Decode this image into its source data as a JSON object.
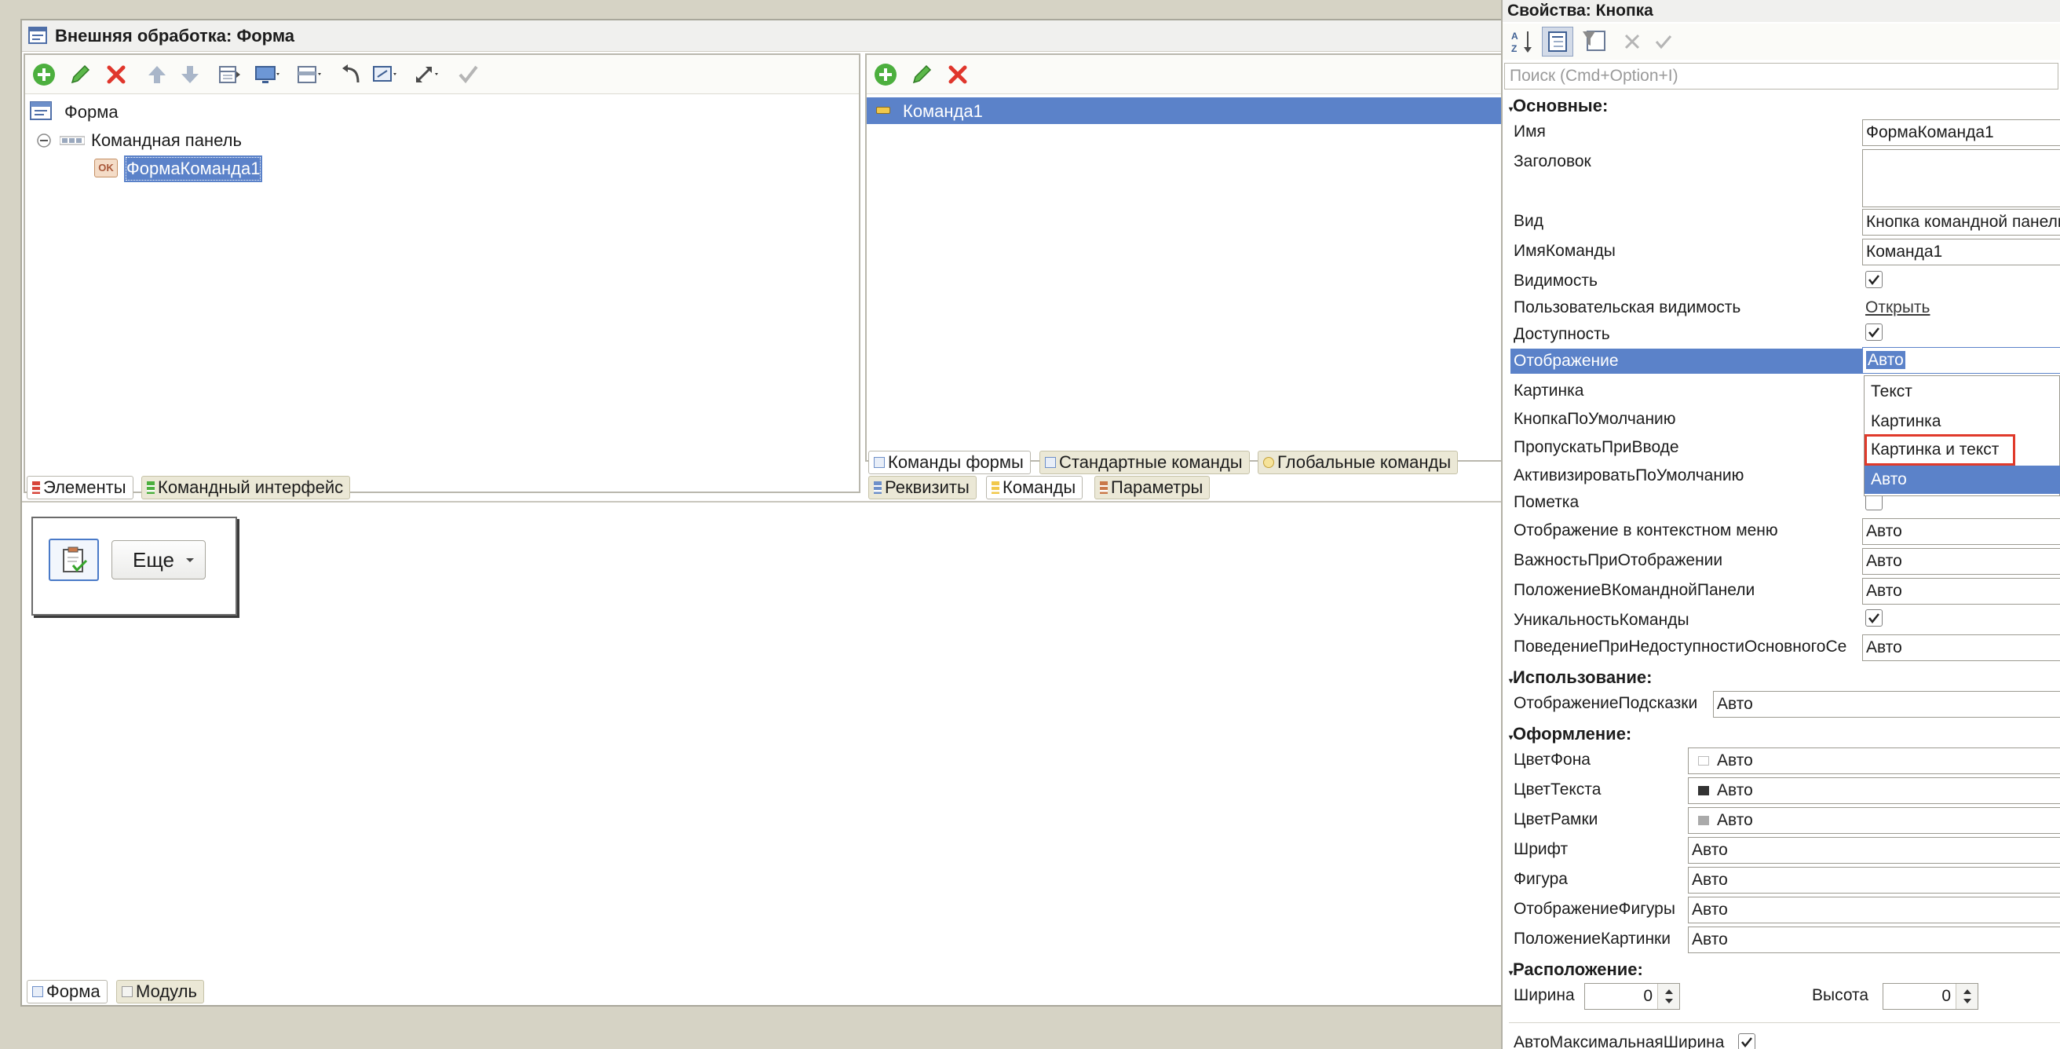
{
  "window": {
    "title": "Внешняя обработка: Форма"
  },
  "elements_pane": {
    "tree": {
      "root": "Форма",
      "command_bar": "Командная панель",
      "selected_item": "ФормаКоманда1",
      "item_badge": "OK"
    },
    "tabs": [
      "Элементы",
      "Командный интерфейс"
    ]
  },
  "commands_pane": {
    "list": [
      "Команда1"
    ],
    "tabs_row1": [
      "Команды формы",
      "Стандартные команды",
      "Глобальные команды"
    ],
    "tabs_row2": [
      "Реквизиты",
      "Команды",
      "Параметры"
    ]
  },
  "preview": {
    "more_button": "Еще"
  },
  "bottom_tabs": [
    "Форма",
    "Модуль"
  ],
  "properties": {
    "title": "Свойства: Кнопка",
    "search_placeholder": "Поиск (Cmd+Option+I)",
    "groups": {
      "main": "Основные:",
      "usage": "Использование:",
      "appearance": "Оформление:",
      "layout": "Расположение:"
    },
    "main": {
      "name_label": "Имя",
      "name_value": "ФормаКоманда1",
      "title_label": "Заголовок",
      "title_value": "",
      "kind_label": "Вид",
      "kind_value": "Кнопка командной панели",
      "command_label": "ИмяКоманды",
      "command_value": "Команда1",
      "visible_label": "Видимость",
      "visible_checked": true,
      "user_visible_label": "Пользовательская видимость",
      "user_visible_link": "Открыть",
      "enabled_label": "Доступность",
      "enabled_checked": true,
      "display_label": "Отображение",
      "display_value": "Авто",
      "picture_label": "Картинка",
      "default_button_label": "КнопкаПоУмолчанию",
      "skip_on_input_label": "ПропускатьПриВводе",
      "activate_default_label": "АктивизироватьПоУмолчанию",
      "check_label": "Пометка",
      "check_checked": false,
      "context_menu_label": "Отображение в контекстном меню",
      "context_menu_value": "Авто",
      "importance_label": "ВажностьПриОтображении",
      "importance_value": "Авто",
      "position_label": "ПоложениеВКоманднойПанели",
      "position_value": "Авто",
      "unique_label": "УникальностьКоманды",
      "unique_checked": true,
      "behavior_label": "ПоведениеПриНедоступностиОсновногоСе",
      "behavior_value": "Авто"
    },
    "usage": {
      "tooltip_label": "ОтображениеПодсказки",
      "tooltip_value": "Авто"
    },
    "appearance": {
      "bg_label": "ЦветФона",
      "bg_value": "Авто",
      "text_color_label": "ЦветТекста",
      "text_color_value": "Авто",
      "border_label": "ЦветРамки",
      "border_value": "Авто",
      "font_label": "Шрифт",
      "font_value": "Авто",
      "shape_label": "Фигура",
      "shape_value": "Авто",
      "shape_display_label": "ОтображениеФигуры",
      "shape_display_value": "Авто",
      "pic_pos_label": "ПоложениеКартинки",
      "pic_pos_value": "Авто"
    },
    "layout": {
      "width_label": "Ширина",
      "width_value": "0",
      "height_label": "Высота",
      "height_value": "0",
      "auto_max_width_label": "АвтоМаксимальнаяШирина",
      "auto_max_width_checked": true
    },
    "display_options": [
      "Текст",
      "Картинка",
      "Картинка и текст",
      "Авто"
    ],
    "highlight_color": "#e03a2b",
    "selection_color": "#5b82c9"
  }
}
